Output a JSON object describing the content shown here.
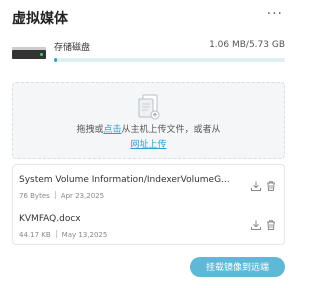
{
  "header": {
    "title": "虚拟媒体",
    "more_icon": "more-horizontal-icon",
    "more_glyph": "···"
  },
  "storage": {
    "label": "存储磁盘",
    "size_text": "1.06 MB/5.73 GB",
    "usage_fraction": 0.0002,
    "accent": "#2ba1c8"
  },
  "dropzone": {
    "text_before": "拖拽或",
    "click_link": "点击",
    "text_after": "从主机上传文件，或者从",
    "url_link": "网址上传"
  },
  "files": [
    {
      "name": "System Volume Information/IndexerVolumeG...",
      "size": "76 Bytes",
      "date": "Apr 23,2025"
    },
    {
      "name": "KVMFAQ.docx",
      "size": "44.17 KB",
      "date": "May 13,2025"
    }
  ],
  "mirror_button": {
    "label": "挂载镜像到远端",
    "color": "#5fb9d6"
  }
}
